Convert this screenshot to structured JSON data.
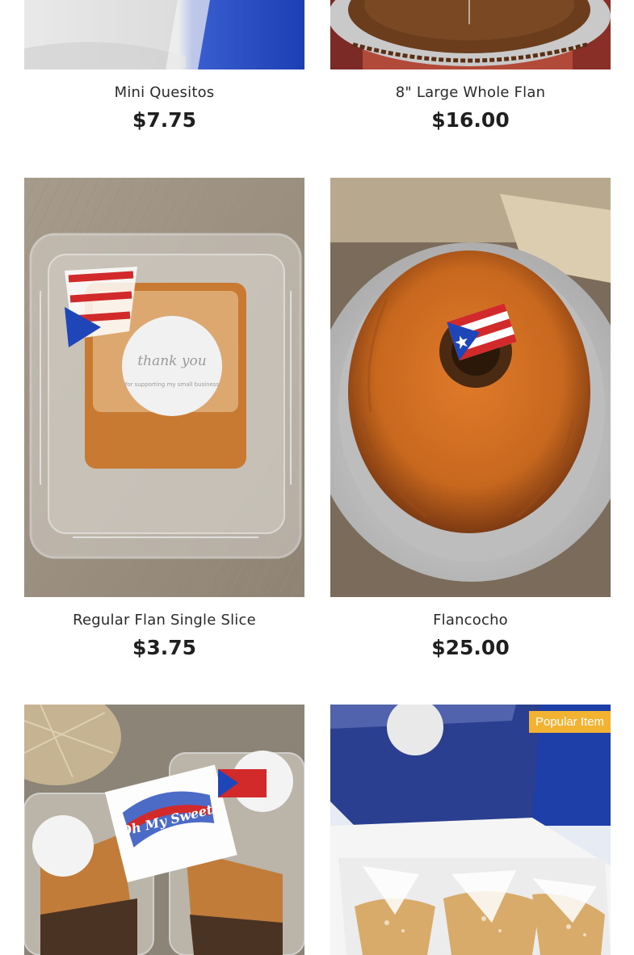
{
  "products": [
    {
      "name": "Mini Quesitos",
      "price": "$7.75"
    },
    {
      "name": "8\" Large Whole Flan",
      "price": "$16.00"
    },
    {
      "name": "Regular Flan Single Slice",
      "price": "$3.75"
    },
    {
      "name": "Flancocho",
      "price": "$25.00"
    },
    {
      "name": "",
      "price": ""
    },
    {
      "name": "",
      "price": "",
      "badge": "Popular Item"
    }
  ],
  "image_text": {
    "thank_you": "thank you",
    "supporting": "for supporting my small business",
    "logo": "Oh My Sweets"
  },
  "colors": {
    "badge": "#f2b232",
    "flag_blue": "#1f46b8",
    "flag_red": "#d22a2a",
    "caramel": "#c8681e"
  }
}
